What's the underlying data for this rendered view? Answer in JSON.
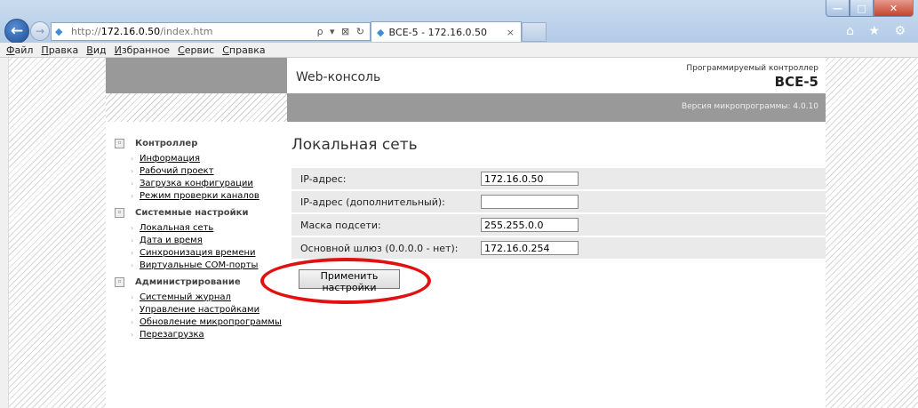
{
  "browser": {
    "url_prefix": "http://",
    "url_host": "172.16.0.50",
    "url_path": "/index.htm",
    "address_controls": "ρ ▾ ⊠ ↻",
    "tab_title": "ВСЕ-5 - 172.16.0.50",
    "tab_close": "×",
    "right_icons": "⌂ ★ ⚙"
  },
  "menu": [
    "Файл",
    "Правка",
    "Вид",
    "Избранное",
    "Сервис",
    "Справка"
  ],
  "header": {
    "console_title": "Web-консоль",
    "product_subtitle": "Программируемый контроллер",
    "product_name": "ВСЕ-5",
    "firmware_version": "Версия микропрограммы: 4.0.10"
  },
  "sidebar": [
    {
      "title": "Контроллер",
      "items": [
        "Информация",
        "Рабочий проект",
        "Загрузка конфигурации",
        "Режим проверки каналов"
      ]
    },
    {
      "title": "Системные настройки",
      "items": [
        "Локальная сеть",
        "Дата и время",
        "Синхронизация времени",
        "Виртуальные COM-порты"
      ]
    },
    {
      "title": "Администрирование",
      "items": [
        "Системный журнал",
        "Управление настройками",
        "Обновление микропрограммы",
        "Перезагрузка"
      ]
    }
  ],
  "main": {
    "title": "Локальная сеть",
    "fields": [
      {
        "label": "IP-адрес:",
        "value": "172.16.0.50"
      },
      {
        "label": "IP-адрес (дополнительный):",
        "value": ""
      },
      {
        "label": "Маска подсети:",
        "value": "255.255.0.0"
      },
      {
        "label": "Основной шлюз (0.0.0.0 - нет):",
        "value": "172.16.0.254"
      }
    ],
    "apply_label": "Применить настройки"
  },
  "colors": {
    "highlight_ring": "#e11111",
    "header_gray": "#999999"
  }
}
